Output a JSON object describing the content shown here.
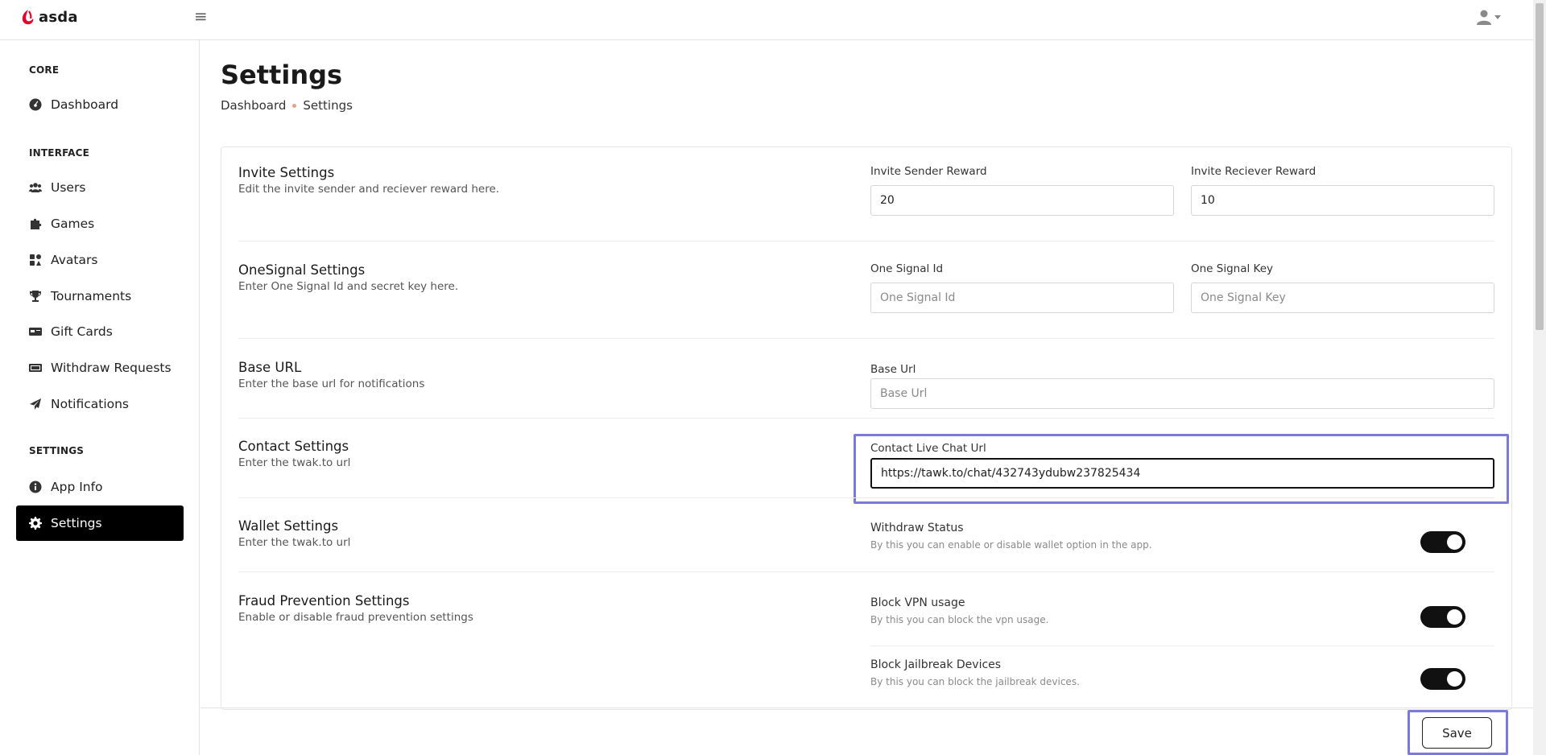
{
  "app": {
    "brand": "asda"
  },
  "sidebar": {
    "headings": {
      "core": "CORE",
      "interface": "INTERFACE",
      "settings": "SETTINGS"
    },
    "items": [
      {
        "label": "Dashboard",
        "icon": "dashboard-icon"
      },
      {
        "label": "Users",
        "icon": "users-icon"
      },
      {
        "label": "Games",
        "icon": "puzzle-icon"
      },
      {
        "label": "Avatars",
        "icon": "avatars-icon"
      },
      {
        "label": "Tournaments",
        "icon": "trophy-icon"
      },
      {
        "label": "Gift Cards",
        "icon": "gift-card-icon"
      },
      {
        "label": "Withdraw Requests",
        "icon": "money-bill-icon"
      },
      {
        "label": "Notifications",
        "icon": "paper-plane-icon"
      },
      {
        "label": "App Info",
        "icon": "info-icon"
      },
      {
        "label": "Settings",
        "icon": "gear-icon",
        "active": true
      }
    ]
  },
  "page": {
    "title": "Settings",
    "breadcrumb": [
      "Dashboard",
      "Settings"
    ]
  },
  "sections": {
    "invite": {
      "title": "Invite Settings",
      "desc": "Edit the invite sender and reciever reward here.",
      "sender_label": "Invite Sender Reward",
      "sender_value": "20",
      "receiver_label": "Invite Reciever Reward",
      "receiver_value": "10"
    },
    "onesignal": {
      "title": "OneSignal Settings",
      "desc": "Enter One Signal Id and secret key here.",
      "id_label": "One Signal Id",
      "id_placeholder": "One Signal Id",
      "key_label": "One Signal Key",
      "key_placeholder": "One Signal Key"
    },
    "baseurl": {
      "title": "Base URL",
      "desc": "Enter the base url for notifications",
      "label": "Base Url",
      "placeholder": "Base Url"
    },
    "contact": {
      "title": "Contact Settings",
      "desc": "Enter the twak.to url",
      "label": "Contact Live Chat Url",
      "value": "https://tawk.to/chat/432743ydubw237825434"
    },
    "wallet": {
      "title": "Wallet Settings",
      "desc": "Enter the twak.to url",
      "toggle_title": "Withdraw Status",
      "toggle_desc": "By this you can enable or disable wallet option in the app.",
      "enabled": true
    },
    "fraud": {
      "title": "Fraud Prevention Settings",
      "desc": "Enable or disable fraud prevention settings",
      "vpn_title": "Block VPN usage",
      "vpn_desc": "By this you can block the vpn usage.",
      "vpn_enabled": true,
      "jb_title": "Block Jailbreak Devices",
      "jb_desc": "By this you can block the jailbreak devices.",
      "jb_enabled": true
    }
  },
  "footer": {
    "save_label": "Save"
  },
  "colors": {
    "accent": "#7b7ad9",
    "logo": "#e4002b",
    "active": "#000000"
  }
}
